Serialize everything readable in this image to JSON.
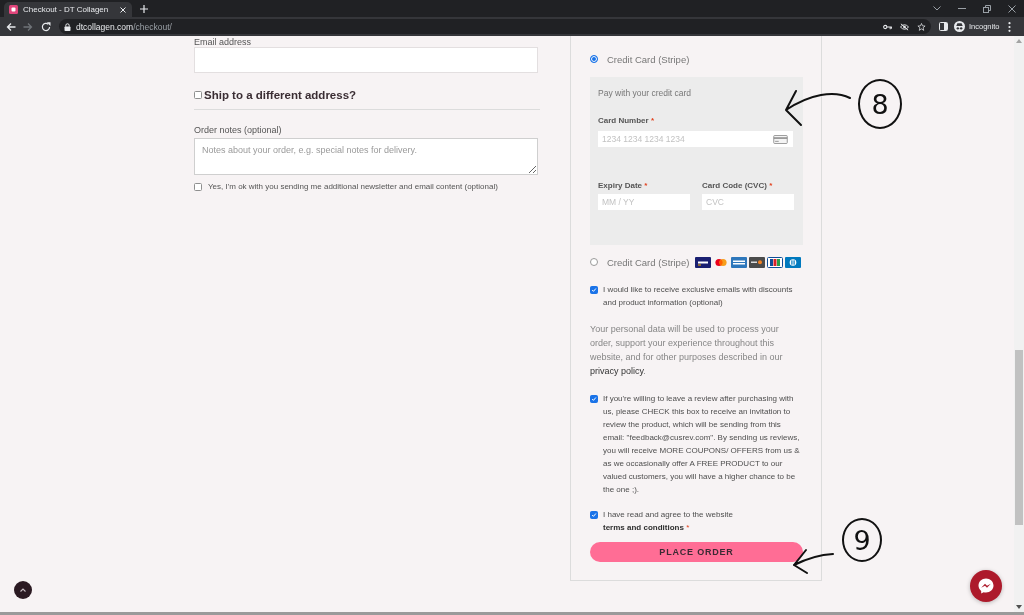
{
  "browser": {
    "tab_title": "Checkout - DT Collagen",
    "url_host": "dtcollagen.com",
    "url_path": "/checkout/",
    "profile": "Incognito"
  },
  "billing": {
    "email_label": "Email address"
  },
  "ship_to_different": {
    "label": "Ship to a different address?",
    "checked": false
  },
  "order_notes": {
    "label": "Order notes (optional)",
    "placeholder": "Notes about your order, e.g. special notes for delivery."
  },
  "newsletter_optin": {
    "label": "Yes, I'm ok with you sending me additional newsletter and email content (optional)",
    "checked": false
  },
  "payment_methods": [
    {
      "kind": "card_form",
      "label": "Credit Card (Stripe)",
      "selected": true,
      "description": "Pay with your credit card",
      "fields": [
        {
          "kind": "card_number",
          "label": "Card Number",
          "required_mark": "*",
          "placeholder": "1234 1234 1234 1234"
        },
        {
          "kind": "short",
          "label": "Expiry Date",
          "required_mark": "*",
          "placeholder": "MM / YY"
        },
        {
          "kind": "short",
          "label": "Card Code (CVC)",
          "required_mark": "*",
          "placeholder": "CVC"
        }
      ]
    },
    {
      "kind": "card_logos",
      "label": "Credit Card (Stripe)",
      "selected": false
    }
  ],
  "marketing_optin": {
    "label": "I would like to receive exclusive emails with discounts and product information (optional)",
    "checked": true
  },
  "privacy_notice": {
    "text": "Your personal data will be used to process your order, support your experience throughout this website, and for other purposes described in our",
    "link": "privacy policy",
    "end": "."
  },
  "review_optin": {
    "label": "If you're willing to leave a review after purchasing with us, please CHECK this box to receive an invitation to review the product, which will be sending from this email: \"feedback@cusrev.com\". By sending us reviews, you will receive MORE COUPONS/ OFFERS from us & as we occasionally offer A FREE PRODUCT to our valued customers, you will have a higher chance to be the one ;).",
    "checked": true
  },
  "terms": {
    "text": "I have read and agree to the website",
    "link": "terms and conditions",
    "required_mark": "*",
    "checked": true
  },
  "place_order": {
    "label": "PLACE ORDER"
  },
  "annotations": [
    {
      "label": "8"
    },
    {
      "label": "9"
    }
  ]
}
